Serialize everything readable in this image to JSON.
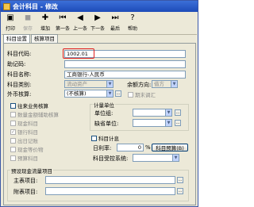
{
  "window": {
    "title": "会计科目 - 修改"
  },
  "toolbar": [
    {
      "label": "打印",
      "icon": "printer-icon",
      "glyph": "▣",
      "disabled": false
    },
    {
      "label": "保存",
      "icon": "save-icon",
      "glyph": "◼",
      "disabled": true
    },
    {
      "label": "增加",
      "icon": "add-icon",
      "glyph": "✚",
      "disabled": false
    },
    {
      "label": "第一条",
      "icon": "first-record-icon",
      "glyph": "⏮",
      "disabled": false
    },
    {
      "label": "上一条",
      "icon": "prev-record-icon",
      "glyph": "◀",
      "disabled": false
    },
    {
      "label": "下一条",
      "icon": "next-record-icon",
      "glyph": "▶",
      "disabled": false
    },
    {
      "label": "最后",
      "icon": "last-record-icon",
      "glyph": "⏭",
      "disabled": false
    },
    {
      "label": "帮助",
      "icon": "help-icon",
      "glyph": "?",
      "disabled": false
    }
  ],
  "tabs": [
    "科目设置",
    "核算项目"
  ],
  "form": {
    "code_label": "科目代码:",
    "code_value": "1002.01",
    "mnemonic_label": "助记码:",
    "mnemonic_value": "",
    "name_label": "科目名称:",
    "name_value": "工商银行-人民币",
    "category_label": "科目类别:",
    "category_value": "流动资产",
    "balance_dir_label": "余额方向:",
    "balance_dir_value": "借方",
    "fx_label": "外币核算:",
    "fx_value": "(不核算)",
    "period_end_label": "期末调汇",
    "account_label": "往来业务核算",
    "qty_label": "数量金额辅助核算",
    "cash_label": "现金科目",
    "bank_label": "银行科目",
    "journal_label": "出日记账",
    "cash_equiv_label": "现金等价物",
    "budget_label": "预算科目",
    "unit_group_label": "计量单位",
    "unit_group_field_label": "单位组:",
    "default_unit_label": "缺省单位:",
    "interest_label": "科目计息",
    "daily_rate_label": "日利率:",
    "daily_rate_value": "0",
    "daily_rate_unit": "%",
    "budget_btn": "科目预算(B)",
    "subject_ctrl_label": "科目受控系统:",
    "cashflow_group_label": "预设现金流量项目",
    "main_item_label": "主表项目:",
    "sub_item_label": "附表项目:"
  }
}
